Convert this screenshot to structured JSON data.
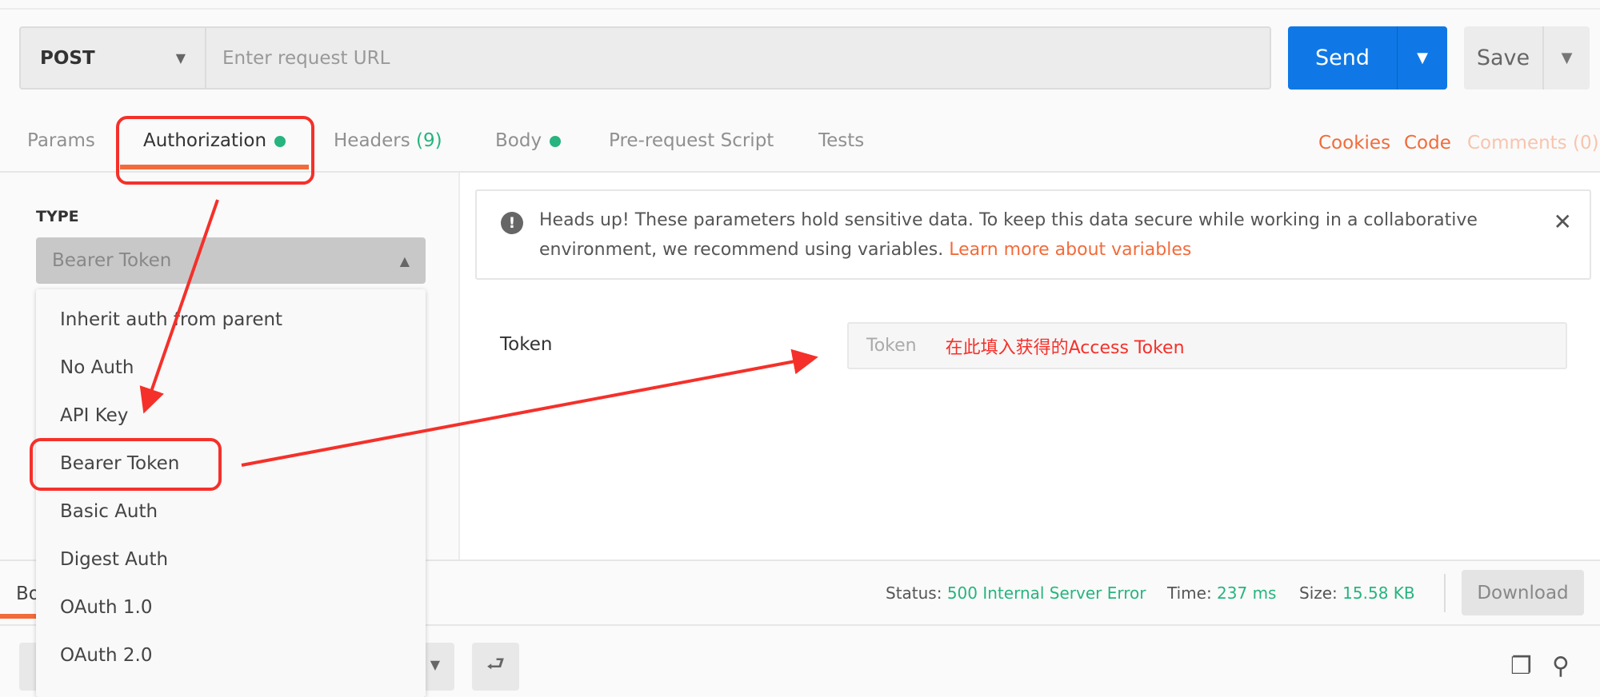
{
  "request": {
    "method": "POST",
    "url_placeholder": "Enter request URL",
    "send_label": "Send",
    "save_label": "Save"
  },
  "tabs": [
    {
      "label": "Params"
    },
    {
      "label": "Authorization",
      "dot": true,
      "active": true
    },
    {
      "label": "Headers",
      "count": "(9)"
    },
    {
      "label": "Body",
      "dot": true
    },
    {
      "label": "Pre-request Script"
    },
    {
      "label": "Tests"
    }
  ],
  "right_links": {
    "cookies": "Cookies",
    "code": "Code",
    "comments": "Comments (0)"
  },
  "auth": {
    "type_label": "TYPE",
    "selected": "Bearer Token",
    "options": [
      "Inherit auth from parent",
      "No Auth",
      "API Key",
      "Bearer Token",
      "Basic Auth",
      "Digest Auth",
      "OAuth 1.0",
      "OAuth 2.0"
    ]
  },
  "notice": {
    "text": "Heads up! These parameters hold sensitive data. To keep this data secure while working in a collaborative environment, we recommend using variables.",
    "link": "Learn more about variables"
  },
  "token": {
    "label": "Token",
    "placeholder": "Token",
    "annotation": "在此填入获得的Access Token"
  },
  "response": {
    "tab_partial": "Bo",
    "status_label": "Status:",
    "status_value": "500 Internal Server Error",
    "time_label": "Time:",
    "time_value": "237 ms",
    "size_label": "Size:",
    "size_value": "15.58 KB",
    "download_label": "Download"
  },
  "colors": {
    "accent": "#f26b3a",
    "send": "#0f78e6",
    "success": "#26b47f",
    "annotation": "#f5302a"
  }
}
